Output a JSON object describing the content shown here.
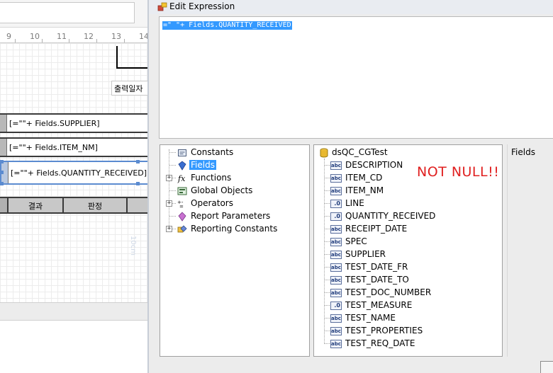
{
  "designer": {
    "ruler_labels": [
      "9",
      "10",
      "11",
      "12",
      "13",
      "14"
    ],
    "print_date_label": "출력일자",
    "rows": [
      {
        "text": "[=\"\"+ Fields.SUPPLIER]"
      },
      {
        "text": "[=\"\"+ Fields.ITEM_NM]"
      },
      {
        "text": "[=\"\"+ Fields.QUANTITY_RECEIVED]"
      }
    ],
    "header_cells": [
      "결과",
      "판정"
    ],
    "watermark": "10cm"
  },
  "dialog": {
    "title": "Edit Expression",
    "expression": "=\" \"+ Fields.QUANTITY_RECEIVED",
    "categories": [
      {
        "label": "Constants",
        "icon": "constants-icon",
        "expandable": false
      },
      {
        "label": "Fields",
        "icon": "fields-icon",
        "expandable": false,
        "selected": true
      },
      {
        "label": "Functions",
        "icon": "function-icon",
        "expandable": true
      },
      {
        "label": "Global Objects",
        "icon": "global-objects-icon",
        "expandable": false
      },
      {
        "label": "Operators",
        "icon": "operators-icon",
        "expandable": true
      },
      {
        "label": "Report Parameters",
        "icon": "report-parameters-icon",
        "expandable": false
      },
      {
        "label": "Reporting Constants",
        "icon": "reporting-constants-icon",
        "expandable": true
      }
    ],
    "dataset": {
      "name": "dsQC_CGTest",
      "icon": "database-icon"
    },
    "fields": [
      {
        "name": "DESCRIPTION",
        "type": "abc"
      },
      {
        "name": "ITEM_CD",
        "type": "abc"
      },
      {
        "name": "ITEM_NM",
        "type": "abc"
      },
      {
        "name": "LINE",
        "type": "num"
      },
      {
        "name": "QUANTITY_RECEIVED",
        "type": "num"
      },
      {
        "name": "RECEIPT_DATE",
        "type": "abc"
      },
      {
        "name": "SPEC",
        "type": "abc"
      },
      {
        "name": "SUPPLIER",
        "type": "abc"
      },
      {
        "name": "TEST_DATE_FR",
        "type": "abc"
      },
      {
        "name": "TEST_DATE_TO",
        "type": "abc"
      },
      {
        "name": "TEST_DOC_NUMBER",
        "type": "abc"
      },
      {
        "name": "TEST_MEASURE",
        "type": "num"
      },
      {
        "name": "TEST_NAME",
        "type": "abc"
      },
      {
        "name": "TEST_PROPERTIES",
        "type": "abc"
      },
      {
        "name": "TEST_REQ_DATE",
        "type": "abc"
      }
    ],
    "description_title": "Fields",
    "annotation": "NOT NULL!!",
    "colors": {
      "selection": "#3399ff",
      "annotation": "#e02020",
      "handle": "#5b8bd0"
    }
  }
}
